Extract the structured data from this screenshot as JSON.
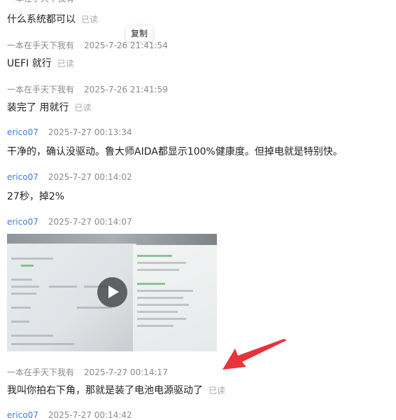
{
  "messages": [
    {
      "id": "m0",
      "text": "什么系统都可以",
      "read": "已读"
    },
    {
      "id": "m1",
      "sender": "一本在手天下我有",
      "time": "2025-7-26 21:41:54",
      "text": "UEFI 就行",
      "read": "已读"
    },
    {
      "id": "m2",
      "sender": "一本在手天下我有",
      "time": "2025-7-26 21:41:59",
      "text": "装完了  用就行",
      "read": "已读"
    },
    {
      "id": "m3",
      "sender": "erico07",
      "time": "2025-7-27 00:13:34",
      "text": "干净的，确认没驱动。鲁大师AIDA都显示100%健康度。但掉电就是特别快。"
    },
    {
      "id": "m4",
      "sender": "erico07",
      "time": "2025-7-27 00:14:02",
      "text": "27秒，掉2%"
    },
    {
      "id": "m5",
      "sender": "erico07",
      "time": "2025-7-27 00:14:07"
    },
    {
      "id": "m6",
      "sender": "一本在手天下我有",
      "time": "2025-7-27 00:14:17",
      "text": "我叫你拍右下角，那就是装了电池电源驱动了",
      "read": "已读"
    },
    {
      "id": "m7",
      "sender": "erico07",
      "time": "2025-7-27 00:14:42"
    }
  ],
  "tooltip": {
    "label": "复制"
  },
  "video": {
    "play_icon": "play-icon"
  },
  "colors": {
    "sender_self": "#8a8a8a",
    "sender_other": "#3f7bd6",
    "read_label": "#a8a8a8",
    "annotation_arrow": "#e8333a"
  }
}
